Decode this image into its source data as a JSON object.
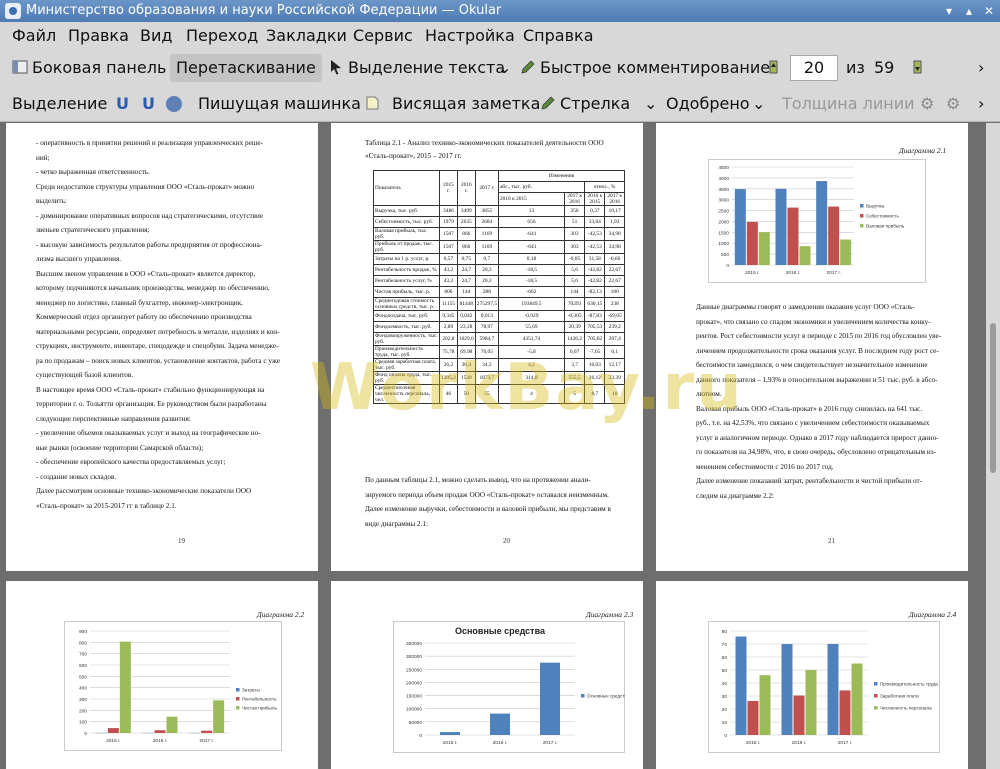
{
  "window": {
    "title": "Министерство образования и науки Российской Федерации  — Okular",
    "minimize": "▾",
    "maximize": "▴",
    "close": "✕"
  },
  "menu": [
    "Файл",
    "Правка",
    "Вид",
    "Переход",
    "Закладки",
    "Сервис",
    "Настройка",
    "Справка"
  ],
  "toolbar1": {
    "sidebar": "Боковая панель",
    "drag": "Перетаскивание",
    "text_select": "Выделение текста",
    "quick_comment": "Быстрое комментирование",
    "page_current": "20",
    "page_of": "из",
    "page_total": "59",
    "more": "›"
  },
  "toolbar2": {
    "selection": "Выделение",
    "typewriter": "Пишущая машинка",
    "note": "Висящая заметка",
    "arrow": "Стрелка",
    "approved": "Одобрено",
    "line_width": "Толщина линии",
    "more": "›"
  },
  "watermark": "WorkBay.ru",
  "pages": {
    "p19": {
      "number": "19",
      "paragraphs": [
        "- оперативность в принятии решений и реализация управленческих реше-",
        "ний;",
        "- четко выраженная ответственность.",
        "Среди недостатков структуры управления ООО «Сталь-прокат» можно",
        "выделить:",
        "- доминирование оперативных вопросов над стратегическими, отсутствие",
        "звеньев стратегического управления;",
        "- высокую зависимость результатов работы предприятия от профессиона-",
        "лизма высшего управления.",
        "Высшим звеном управления в ООО «Сталь-прокат» является директор,",
        "которому подчиняются начальник производства, менеджер по обеспечению,",
        "менеджер по логистике, главный бухгалтер, инженер-электронщик.",
        "Коммерческий отдел организует работу по обеспечению производства",
        "материальными ресурсами, определяет потребность в металле, изделиях и кон-",
        "струкциях, инструменте, инвентаре, спецодежде и спецобуви. Задача менедже-",
        "ра по продажам – поиск новых клиентов, установление контактов, работа с уже",
        "существующей базой клиентов.",
        "В настоящее время ООО «Сталь-прокат» стабильно функционирующая на",
        "территории г. о. Тольятти организация. Ее руководством были разработаны",
        "следующие перспективные направления развития:",
        "- увеличение объемов оказываемых услуг и выход на географические но-",
        "вые рынки (освоение территории Самарской области);",
        "- обеспечение европейского качества предоставляемых услуг;",
        "- создание новых складов.",
        "Далее рассмотрим основные технико-экономические показатели ООО",
        "«Сталь-прокат» за 2015-2017 гг в таблице 2.1."
      ]
    },
    "p20": {
      "number": "20",
      "caption": "Таблица 2.1 - Анализ технико-экономических показателей деятельности ООО «Сталь-прокат», 2015 – 2017 гг.",
      "header": {
        "indicator": "Показатель",
        "y2015": "2015 г.",
        "y2016": "2016 г.",
        "y2017": "2017 г.",
        "changes": "Изменения",
        "abs": "абс., тыс. руб.",
        "rel": "относ., %",
        "c1": "2016 к 2015",
        "c2": "2017 к 2016",
        "c3": "2016 к 2015",
        "c4": "2017 к 2016"
      },
      "rows": [
        [
          "Выручка, тыс. руб.",
          "3486",
          "3499",
          "3855",
          "13",
          "356",
          "0,37",
          "10,17"
        ],
        [
          "Себестоимость, тыс. руб.",
          "1979",
          "2635",
          "2684",
          "656",
          "51",
          "33,04",
          "1,93"
        ],
        [
          "Валовая прибыль, тыс. руб.",
          "1507",
          "866",
          "1169",
          "-641",
          "303",
          "-42,53",
          "34,98"
        ],
        [
          "Прибыль от продаж, тыс. руб.",
          "1507",
          "866",
          "1169",
          "-641",
          "303",
          "-42,53",
          "34,98"
        ],
        [
          "Затраты на 1 р. услуг, р.",
          "0,57",
          "0,75",
          "0,7",
          "0,18",
          "-0,05",
          "31,58",
          "-6,66"
        ],
        [
          "Рентабельность продаж, %",
          "43,2",
          "24,7",
          "20,3",
          "-18,5",
          "5,6",
          "-42,82",
          "22,67"
        ],
        [
          "Рентабельность услуг, %",
          "43,2",
          "24,7",
          "20,3",
          "-18,5",
          "5,6",
          "-42,82",
          "22,67"
        ],
        [
          "Чистая прибыль, тыс. р.",
          "806",
          "144",
          "288",
          "-662",
          "144",
          "-82,13",
          "100"
        ],
        [
          "Среднегодовая стоимость основных средств, тыс. р.",
          "11155",
          "81448",
          "275297,5",
          "193849,5",
          "70293",
          "630,15",
          "238"
        ],
        [
          "Фондоотдача, тыс. руб.",
          "0,345",
          "0,042",
          "0,013",
          "-0,029",
          "-0,305",
          "-87,83",
          "-69,05"
        ],
        [
          "Фондоемкость, тыс. руб.",
          "2,89",
          "23,28",
          "78,97",
          "55,69",
          "20,39",
          "705,53",
          "239,2"
        ],
        [
          "Фондовооруженность, тыс. руб.",
          "202,8",
          "1629,0",
          "5984,7",
          "4351,74",
          "1426,2",
          "705,82",
          "267,4"
        ],
        [
          "Производительность труда, тыс. руб.",
          "75,78",
          "69,98",
          "70,05",
          "-5,8",
          "0,07",
          "-7,65",
          "0,1"
        ],
        [
          "Средняя заработная плата, тыс. руб.",
          "26,2",
          "30,4",
          "34,3",
          "4,2",
          "3,7",
          "16,03",
          "12,17"
        ],
        [
          "Фонд оплаты труда, тыс. руб.",
          "1205,2",
          "1520",
          "1873,7",
          "314,8",
          "555,5",
          "26,12",
          "23,39"
        ],
        [
          "Среднесписочная численность персонала, чел.",
          "46",
          "50",
          "55",
          "4",
          "5",
          "8,7",
          "10"
        ]
      ],
      "paragraphs": [
        "По данным таблицы 2.1, можно сделать вывод, что на протяжении анали-",
        "зируемого периода объем продаж ООО «Сталь-прокат» оставался неизменным.",
        "Далее изменение выручки, себестоимости и валовой прибыли, мы представим в",
        "виде диаграммы 2.1:"
      ]
    },
    "p21": {
      "number": "21",
      "caption": "Диаграмма 2.1",
      "paragraphs": [
        "Данные диаграммы говорят о замедлении оказания услуг ООО «Сталь-",
        "прокат», что связано со спадом экономики и увеличением количества конку-",
        "рентов. Рост себестоимости услуг в периоде с 2015 по 2016 год обусловлен уве-",
        "личением продолжительности срока оказания услуг. В последнем году рост се-",
        "бестоимости замедлился, о чем свидетельствует незначительное изменение",
        "данного показателя – 1,93% в относительном выражении и 51 тыс. руб. в абсо-",
        "лютном.",
        "Валовая прибыль ООО «Сталь-прокат» в 2016 году снизилась на 641 тыс.",
        "руб., т.е. на 42,53%, что связано с увеличением себестоимости оказываемых",
        "услуг в аналогичном периоде. Однако в 2017 году наблюдается прирост данно-",
        "го показателя на 34,98%, что, в свою очередь, обусловлено отрицательным из-",
        "менением себестоимости с 2016 по 2017 год.",
        "Далее изменение показаний затрат, рентабельности и чистой прибыли от-",
        "следим на диаграмме 2.2:"
      ]
    },
    "p22": {
      "caption": "Диаграмма 2.2"
    },
    "p23": {
      "caption": "Диаграмма 2.3"
    },
    "p24": {
      "caption": "Диаграмма 2.4"
    }
  },
  "chart_data": [
    {
      "id": "d21",
      "type": "bar",
      "categories": [
        "2015 г.",
        "2016 г.",
        "2017 г."
      ],
      "ylim": [
        0,
        4500
      ],
      "yticks": [
        "0",
        "500",
        "1000",
        "1500",
        "2000",
        "2500",
        "3000",
        "3500",
        "4000",
        "4500"
      ],
      "series": [
        {
          "name": "Выручка",
          "values": [
            3486,
            3499,
            3855
          ]
        },
        {
          "name": "Себестоимость",
          "values": [
            1979,
            2635,
            2684
          ]
        },
        {
          "name": "Валовая прибыль",
          "values": [
            1507,
            866,
            1169
          ]
        }
      ],
      "colors": [
        "#4f81bd",
        "#c0504d",
        "#9bbb59"
      ],
      "legend": "right",
      "grid": true
    },
    {
      "id": "d22",
      "type": "bar",
      "categories": [
        "2015 г.",
        "2016 г.",
        "2017 г."
      ],
      "ylim": [
        0,
        900
      ],
      "yticks": [
        "0",
        "100",
        "200",
        "300",
        "400",
        "500",
        "600",
        "700",
        "800",
        "900"
      ],
      "series": [
        {
          "name": "Затраты",
          "values": [
            0.57,
            0.75,
            0.7
          ]
        },
        {
          "name": "Рентабельность",
          "values": [
            43.2,
            24.7,
            20.3
          ]
        },
        {
          "name": "Чистая прибыль",
          "values": [
            806,
            144,
            288
          ]
        }
      ],
      "colors": [
        "#4f81bd",
        "#c0504d",
        "#9bbb59"
      ],
      "legend": "right",
      "grid": true
    },
    {
      "id": "d23",
      "type": "bar",
      "title": "Основные средства",
      "categories": [
        "2015 г.",
        "2016 г.",
        "2017 г."
      ],
      "ylim": [
        0,
        350000
      ],
      "yticks": [
        "0",
        "50000",
        "100000",
        "150000",
        "200000",
        "250000",
        "300000",
        "350000"
      ],
      "series": [
        {
          "name": "Основные средства",
          "values": [
            11155,
            81448,
            275297.5
          ]
        }
      ],
      "colors": [
        "#4f81bd"
      ],
      "legend": "right",
      "grid": true
    },
    {
      "id": "d24",
      "type": "bar",
      "categories": [
        "2015 г.",
        "2016 г.",
        "2017 г."
      ],
      "ylim": [
        0,
        80
      ],
      "yticks": [
        "0",
        "10",
        "20",
        "30",
        "40",
        "50",
        "60",
        "70",
        "80"
      ],
      "series": [
        {
          "name": "Производительность труда",
          "values": [
            75.78,
            69.98,
            70.05
          ]
        },
        {
          "name": "Заработная плата",
          "values": [
            26.2,
            30.4,
            34.3
          ]
        },
        {
          "name": "Численность персонала",
          "values": [
            46,
            50,
            55
          ]
        }
      ],
      "colors": [
        "#4f81bd",
        "#c0504d",
        "#9bbb59"
      ],
      "legend": "right",
      "grid": true
    }
  ]
}
